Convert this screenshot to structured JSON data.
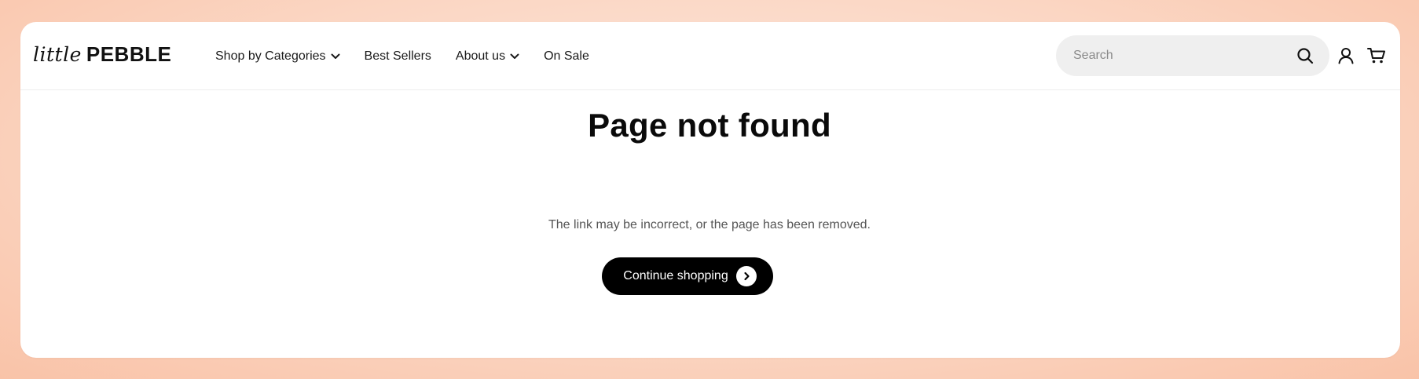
{
  "brand": {
    "script": "little",
    "bold": "PEBBLE"
  },
  "nav": {
    "items": [
      {
        "label": "Shop by Categories",
        "has_dropdown": true,
        "icon": "chevron-down-icon"
      },
      {
        "label": "Best Sellers",
        "has_dropdown": false
      },
      {
        "label": "About us",
        "has_dropdown": true,
        "icon": "chevron-down-icon"
      },
      {
        "label": "On Sale",
        "has_dropdown": false
      }
    ]
  },
  "search": {
    "placeholder": "Search",
    "value": "",
    "icon": "search-icon"
  },
  "header_icons": [
    "user-icon",
    "cart-icon"
  ],
  "main": {
    "title": "Page not found",
    "subtitle": "The link may be incorrect, or the page has been removed.",
    "cta_label": "Continue shopping",
    "cta_icon": "chevron-right-icon"
  },
  "colors": {
    "background_gradient": [
      "#fce9df",
      "#f9c3a8"
    ],
    "card": "#ffffff",
    "search_bg": "#efefef",
    "cta_bg": "#000000",
    "cta_text": "#ffffff",
    "text": "#0a0a0a",
    "muted_text": "#555555"
  }
}
